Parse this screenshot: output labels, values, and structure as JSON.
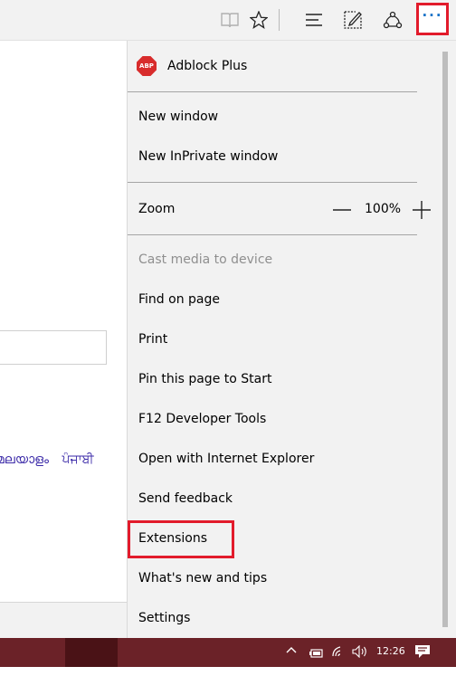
{
  "menu": {
    "adblock_label": "Adblock Plus",
    "adblock_icon_text": "ABP",
    "new_window": "New window",
    "new_inprivate": "New InPrivate window",
    "zoom_label": "Zoom",
    "zoom_value": "100%",
    "cast_media": "Cast media to device",
    "find_on_page": "Find on page",
    "print": "Print",
    "pin_to_start": "Pin this page to Start",
    "dev_tools": "F12 Developer Tools",
    "open_ie": "Open with Internet Explorer",
    "send_feedback": "Send feedback",
    "extensions": "Extensions",
    "whats_new": "What's new and tips",
    "settings": "Settings"
  },
  "page": {
    "lang_links": [
      "മലയാളം",
      "ਪੰਜਾਬੀ"
    ]
  },
  "toolbar": {
    "icons": [
      "reading-view-icon",
      "favorite-star-icon",
      "hub-icon",
      "web-note-icon",
      "share-icon",
      "more-icon"
    ]
  },
  "taskbar": {
    "clock": "12:26"
  },
  "colors": {
    "highlight": "#e21b2b",
    "accent": "#1a73c8",
    "taskbar": "#6b2228"
  }
}
